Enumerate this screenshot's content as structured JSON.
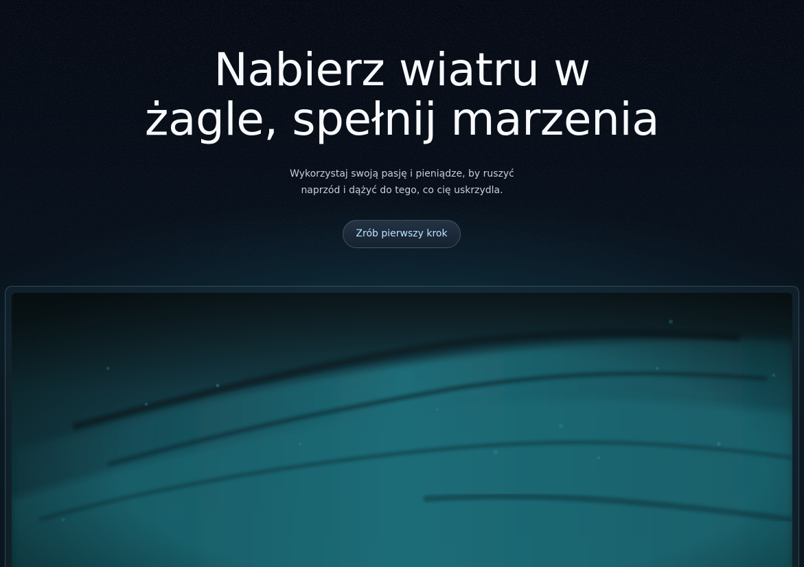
{
  "hero": {
    "headline_line1": "Nabierz wiatru w",
    "headline_line2": "żagle, spełnij marzenia",
    "subtext_line1": "Wykorzystaj swoją pasję i pieniądze, by ruszyć",
    "subtext_line2": "naprzód i dążyć do tego, co cię uskrzydla.",
    "cta_label": "Zrób pierwszy krok"
  },
  "colors": {
    "background": "#070c16",
    "headline": "#f7f9fc",
    "subtext": "#c9cfd8",
    "cta_text": "#b9e4ff",
    "water_accent": "#1d6f7a"
  },
  "media": {
    "description_icon": "ocean-wave-image"
  }
}
